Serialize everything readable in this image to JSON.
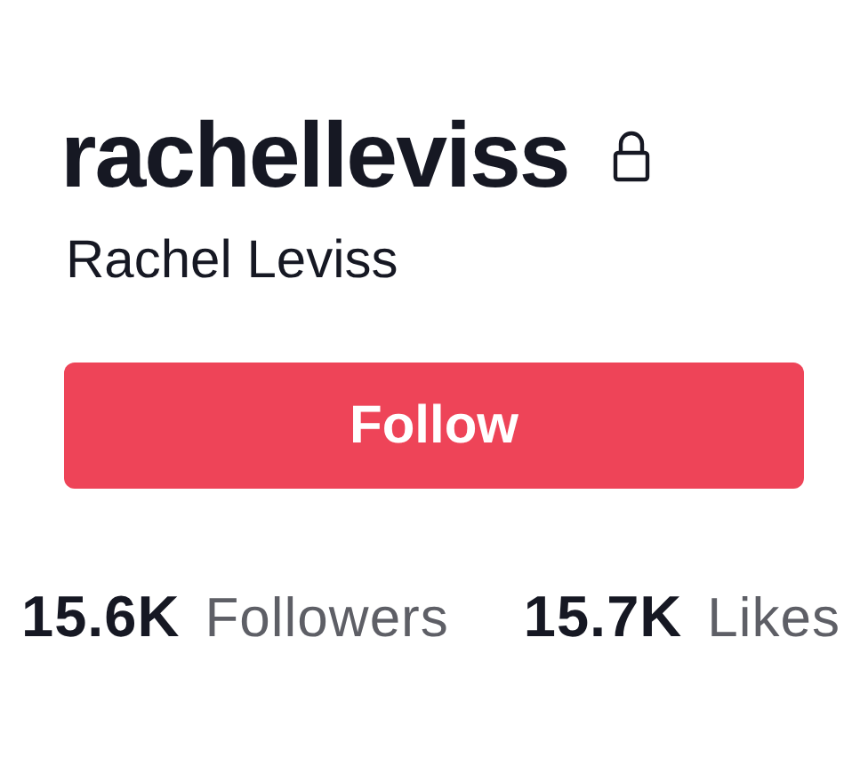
{
  "profile": {
    "username": "rachelleviss",
    "private": true,
    "display_name": "Rachel Leviss"
  },
  "follow_button": {
    "label": "Follow"
  },
  "stats": [
    {
      "count": "15.6K",
      "name": "Followers"
    },
    {
      "count": "15.7K",
      "name": "Likes"
    }
  ]
}
